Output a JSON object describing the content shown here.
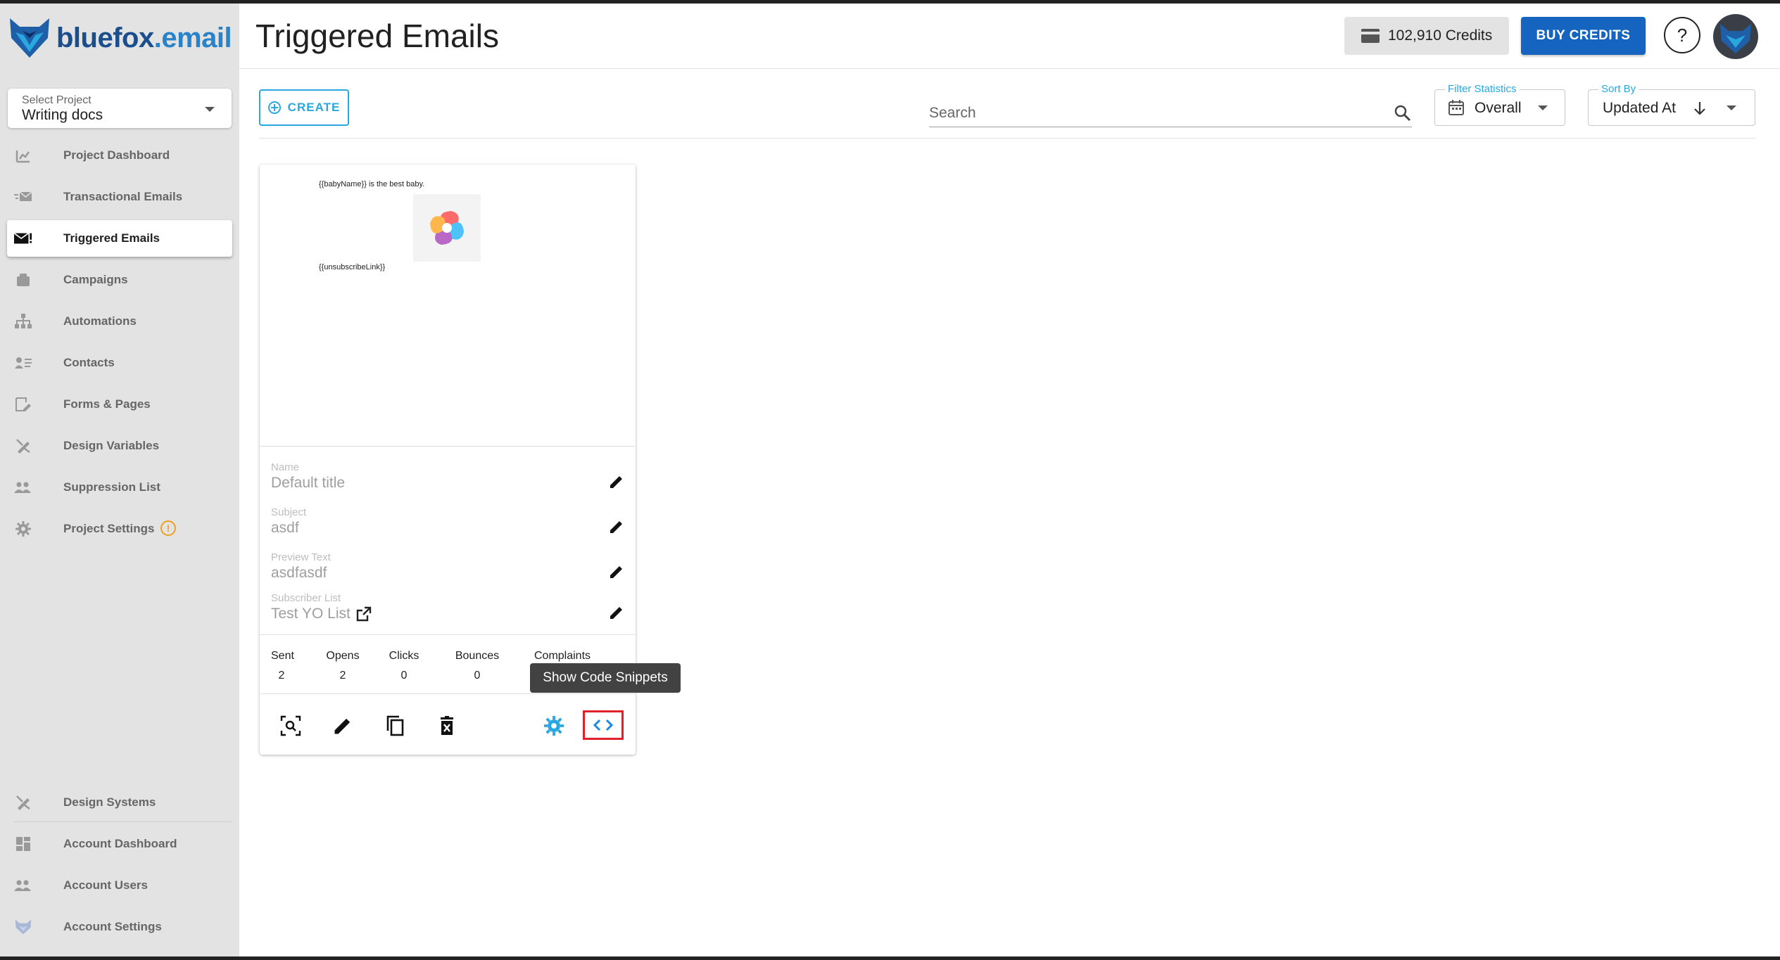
{
  "brand": {
    "name_main": "bluefox",
    "name_dot": ".email"
  },
  "sidebar": {
    "project_label": "Select Project",
    "project_value": "Writing docs",
    "items": [
      {
        "label": "Project Dashboard",
        "icon": "chart-icon"
      },
      {
        "label": "Transactional Emails",
        "icon": "fast-mail-icon"
      },
      {
        "label": "Triggered Emails",
        "icon": "mail-alert-icon",
        "active": true
      },
      {
        "label": "Campaigns",
        "icon": "campaign-icon"
      },
      {
        "label": "Automations",
        "icon": "sitemap-icon"
      },
      {
        "label": "Contacts",
        "icon": "contacts-icon"
      },
      {
        "label": "Forms & Pages",
        "icon": "form-edit-icon"
      },
      {
        "label": "Design Variables",
        "icon": "design-tools-icon"
      },
      {
        "label": "Suppression List",
        "icon": "people-block-icon"
      },
      {
        "label": "Project Settings",
        "icon": "gear-icon",
        "badge": "!"
      }
    ],
    "bottom_items": [
      {
        "label": "Design Systems",
        "icon": "design-tools-icon"
      },
      {
        "label": "Account Dashboard",
        "icon": "dashboard-icon"
      },
      {
        "label": "Account Users",
        "icon": "people-icon"
      },
      {
        "label": "Account Settings",
        "icon": "fox-icon"
      }
    ]
  },
  "header": {
    "title": "Triggered Emails",
    "credits": "102,910 Credits",
    "buy_label": "BUY CREDITS",
    "help_label": "?"
  },
  "toolbar": {
    "create_label": "CREATE",
    "search_placeholder": "Search",
    "filter_label": "Filter Statistics",
    "filter_value": "Overall",
    "sort_label": "Sort By",
    "sort_value": "Updated At"
  },
  "card": {
    "preview_line1": "{{babyName}} is the best baby.",
    "preview_line2": "{{unsubscribeLink}}",
    "fields": [
      {
        "label": "Name",
        "value": "Default title"
      },
      {
        "label": "Subject",
        "value": "asdf"
      },
      {
        "label": "Preview Text",
        "value": "asdfasdf"
      },
      {
        "label": "Subscriber List",
        "value": "Test YO List"
      }
    ],
    "stats": [
      {
        "label": "Sent",
        "value": "2"
      },
      {
        "label": "Opens",
        "value": "2"
      },
      {
        "label": "Clicks",
        "value": "0"
      },
      {
        "label": "Bounces",
        "value": "0"
      },
      {
        "label": "Complaints",
        "value": ""
      }
    ],
    "tooltip": "Show Code Snippets"
  },
  "colors": {
    "accent": "#29a8e0",
    "primary": "#1565c0",
    "highlight": "#e0202a",
    "sidebar_bg": "#e3e3e3"
  }
}
